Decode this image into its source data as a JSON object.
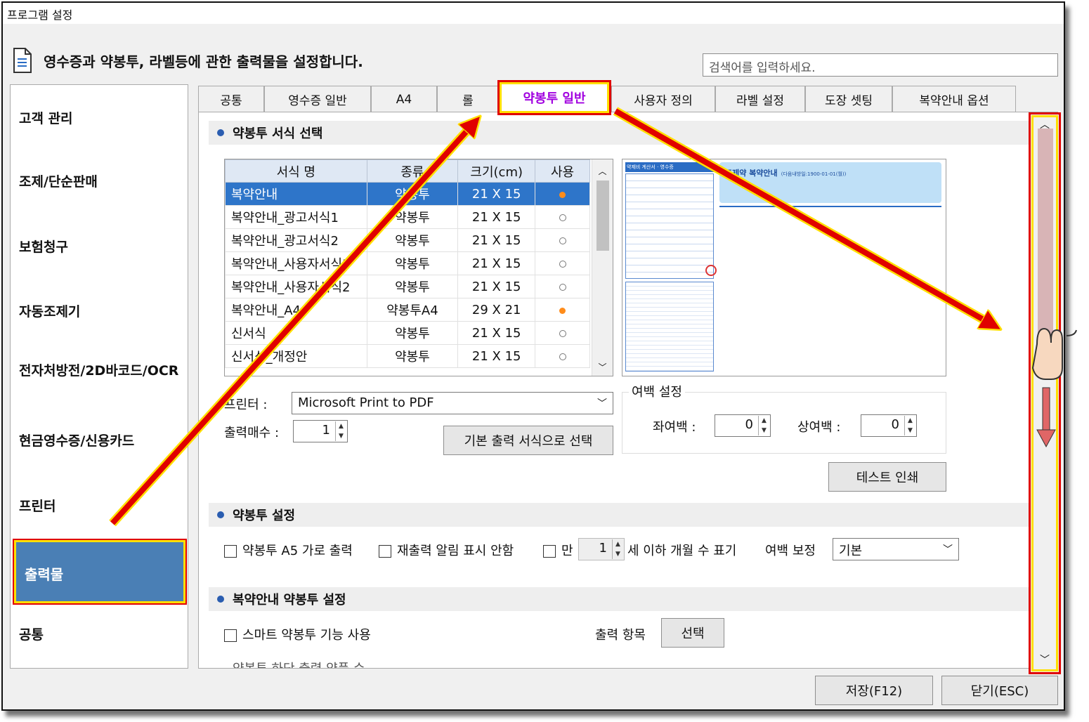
{
  "window": {
    "title": "프로그램 설정"
  },
  "header": {
    "description": "영수증과 약봉투, 라벨등에 관한 출력물을 설정합니다.",
    "search_placeholder": "검색어를 입력하세요."
  },
  "sidebar": {
    "items": [
      "고객 관리",
      "조제/단순판매",
      "보험청구",
      "자동조제기",
      "전자처방전/2D바코드/OCR",
      "현금영수증/신용카드",
      "프린터",
      "출력물",
      "공통"
    ],
    "active_index": 7
  },
  "tabs": {
    "items": [
      "공통",
      "영수증 일반",
      "A4",
      "롤",
      "약봉투 일반",
      "사용자 정의",
      "라벨 설정",
      "도장 셋팅",
      "복약안내 옵션"
    ],
    "active_index": 4
  },
  "section1": {
    "title": "약봉투 서식 선택",
    "table": {
      "columns": [
        "서식 명",
        "종류",
        "크기(cm)",
        "사용"
      ],
      "rows": [
        {
          "name": "복약안내",
          "type": "약봉투",
          "size": "21 X 15",
          "used": true,
          "selected": true
        },
        {
          "name": "복약안내_광고서식1",
          "type": "약봉투",
          "size": "21 X 15",
          "used": false
        },
        {
          "name": "복약안내_광고서식2",
          "type": "약봉투",
          "size": "21 X 15",
          "used": false
        },
        {
          "name": "복약안내_사용자서식1",
          "type": "약봉투",
          "size": "21 X 15",
          "used": false
        },
        {
          "name": "복약안내_사용자서식2",
          "type": "약봉투",
          "size": "21 X 15",
          "used": false
        },
        {
          "name": "복약안내_A4",
          "type": "약봉투A4",
          "size": "29 X 21",
          "used": true
        },
        {
          "name": "신서식",
          "type": "약봉투",
          "size": "21 X 15",
          "used": false
        },
        {
          "name": "신서식_개정안",
          "type": "약봉투",
          "size": "21 X 15",
          "used": false
        }
      ]
    },
    "printer_label": "프린터 :",
    "printer_value": "Microsoft Print to PDF",
    "copies_label": "출력매수 :",
    "copies_value": "1",
    "default_button": "기본 출력 서식으로 선택",
    "margin_group": "여백 설정",
    "left_margin_label": "좌여백 :",
    "left_margin_value": "0",
    "top_margin_label": "상여백 :",
    "top_margin_value": "0",
    "test_print_button": "테스트 인쇄",
    "preview": {
      "header_left": "약제비 계산서 · 영수증",
      "header_title": "조제약 복약안내",
      "header_date": "(다음내방일:1900-01-01(월))"
    }
  },
  "section2": {
    "title": "약봉투 설정",
    "a5_label": "약봉투 A5 가로 출력",
    "reprint_label": "재출력 알림 표시 안함",
    "age_prefix": "만",
    "age_value": "1",
    "age_suffix": "세 이하 개월 수 표기",
    "margin_fix_label": "여백 보정",
    "margin_fix_value": "기본"
  },
  "section3": {
    "title": "복약안내 약봉투 설정",
    "smart_label": "스마트 약봉투 기능 사용",
    "output_items_label": "출력 항목",
    "select_button": "선택",
    "cut_text": "약봉투 하단 출력 약품 수"
  },
  "footer": {
    "save_button": "저장(F12)",
    "close_button": "닫기(ESC)"
  },
  "annotations": {
    "highlight_color": "#e00000",
    "outline_color": "#ffdf00"
  }
}
